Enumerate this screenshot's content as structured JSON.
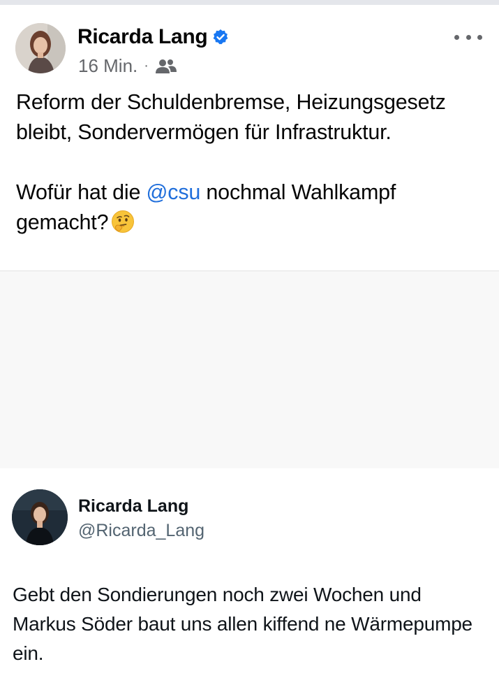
{
  "facebook_post": {
    "author_name": "Ricarda Lang",
    "verified": true,
    "timestamp": "16 Min.",
    "separator": "·",
    "audience_icon": "friends-icon",
    "more_icon": "more-options-icon",
    "text_line_1": "Reform der Schuldenbremse, Heizungsgesetz bleibt, Sondervermögen für Infrastruktur.",
    "text_line_2_before": "Wofür hat die ",
    "mention": "@csu",
    "text_line_2_after": " nochmal Wahlkampf gemacht?",
    "emoji": "thinking-face-emoji",
    "colors": {
      "mention": "#216fdb",
      "verified": "#1877f2",
      "meta": "#65676b"
    }
  },
  "tweet": {
    "author_name": "Ricarda Lang",
    "handle": "@Ricarda_Lang",
    "text": "Gebt den Sondierungen noch zwei Wochen und Markus Söder baut uns allen kiffend ne Wärmepumpe ein."
  }
}
